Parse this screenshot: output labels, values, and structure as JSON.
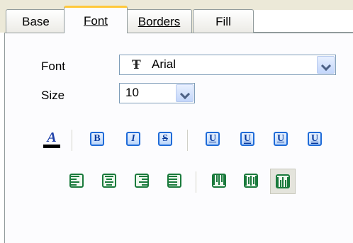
{
  "tabs": [
    {
      "label": "Base",
      "active": false
    },
    {
      "label": "Font",
      "active": true
    },
    {
      "label": "Borders",
      "active": false
    },
    {
      "label": "Fill",
      "active": false
    }
  ],
  "font": {
    "label": "Font",
    "value": "Arial",
    "glyph": "Ŧ"
  },
  "size": {
    "label": "Size",
    "value": "10"
  },
  "style_toolbar": {
    "color_glyph": "A",
    "bold": "B",
    "italic": "I",
    "strike": "S",
    "underline": [
      "U",
      "U",
      "U",
      "U"
    ]
  },
  "icons": {
    "font_color": "font-color-icon",
    "bold": "bold-icon",
    "italic": "italic-icon",
    "strikeout": "strikeout-icon",
    "underline": "underline-icon",
    "align_left": "align-left-icon",
    "align_center": "align-center-icon",
    "align_right": "align-right-icon",
    "align_justify": "align-justify-icon",
    "valign_top": "vertical-align-top-icon",
    "valign_center": "vertical-align-center-icon",
    "valign_bottom": "vertical-align-bottom-icon"
  },
  "colors": {
    "accent": "#1f6bd8",
    "align_icon": "#1a7a3c",
    "tab_highlight": "#ffc83c"
  }
}
